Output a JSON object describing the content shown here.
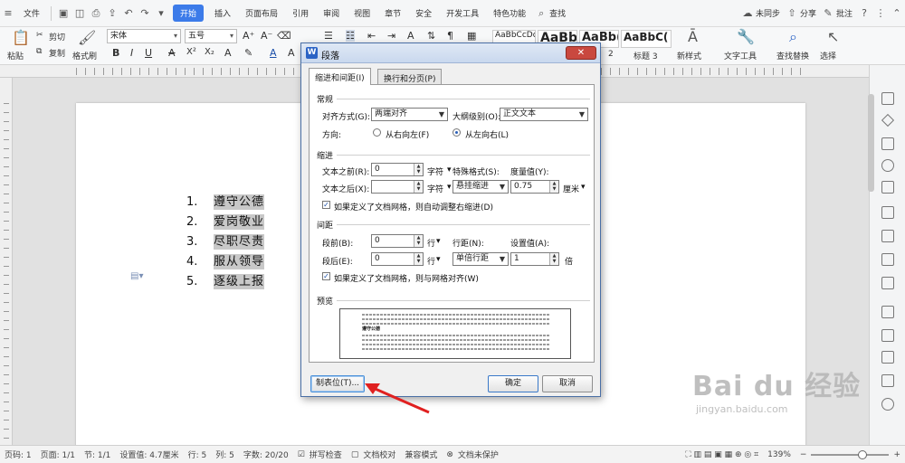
{
  "menubar": {
    "file": "文件",
    "tabs": [
      "开始",
      "插入",
      "页面布局",
      "引用",
      "审阅",
      "视图",
      "章节",
      "安全",
      "开发工具",
      "特色功能"
    ],
    "search": "查找",
    "sync": "未同步",
    "share": "分享",
    "comment": "批注",
    "help": "?",
    "more": "⋮"
  },
  "ribbon": {
    "paste": "粘贴",
    "cut": "剪切",
    "copy": "复制",
    "format_painter": "格式刷",
    "font_name": "宋体",
    "font_size": "五号",
    "styles": [
      "AaBbCcDd",
      "AaBb",
      "AaBb(",
      "AaBbC("
    ],
    "style_labels": [
      "2",
      "标题 3"
    ],
    "new_style": "新样式",
    "text_tools": "文字工具",
    "find_replace": "查找替换",
    "select": "选择"
  },
  "document": {
    "list": [
      {
        "num": "1.",
        "text": "遵守公德"
      },
      {
        "num": "2.",
        "text": "爱岗敬业"
      },
      {
        "num": "3.",
        "text": "尽职尽责"
      },
      {
        "num": "4.",
        "text": "服从领导"
      },
      {
        "num": "5.",
        "text": "逐级上报"
      }
    ]
  },
  "dialog": {
    "title": "段落",
    "close": "✕",
    "tabs": [
      "缩进和间距(I)",
      "换行和分页(P)"
    ],
    "general": {
      "header": "常规",
      "align_label": "对齐方式(G):",
      "align_value": "两端对齐",
      "outline_label": "大纲级别(O):",
      "outline_value": "正文文本",
      "direction_label": "方向:",
      "rtl": "从右向左(F)",
      "ltr": "从左向右(L)"
    },
    "indent": {
      "header": "缩进",
      "before_label": "文本之前(R):",
      "before_value": "0",
      "before_unit": "字符",
      "after_label": "文本之后(X):",
      "after_value": "",
      "after_unit": "字符",
      "special_label": "特殊格式(S):",
      "special_value": "悬挂缩进",
      "measure_label": "度量值(Y):",
      "measure_value": "0.75",
      "measure_unit": "厘米",
      "auto_adjust": "如果定义了文档网格，则自动调整右缩进(D)"
    },
    "spacing": {
      "header": "间距",
      "before_label": "段前(B):",
      "before_value": "0",
      "before_unit": "行",
      "after_label": "段后(E):",
      "after_value": "0",
      "after_unit": "行",
      "line_label": "行距(N):",
      "line_value": "单倍行距",
      "setting_label": "设置值(A):",
      "setting_value": "1",
      "setting_unit": "倍",
      "grid_align": "如果定义了文档网格，则与网格对齐(W)"
    },
    "preview": {
      "header": "预览",
      "sample": "遵守公德"
    },
    "buttons": {
      "tabs": "制表位(T)...",
      "ok": "确定",
      "cancel": "取消"
    }
  },
  "statusbar": {
    "page_no": "页码: 1",
    "pages": "页面: 1/1",
    "section": "节: 1/1",
    "setting": "设置值: 4.7厘米",
    "row": "行: 5",
    "col": "列: 5",
    "words": "字数: 20/20",
    "spellcheck": "拼写检查",
    "doc_check": "文档校对",
    "compat": "兼容模式",
    "protect": "文档未保护",
    "zoom": "139%",
    "minus": "−",
    "plus": "+"
  },
  "watermark": {
    "text": "Bai du 经验",
    "url": "jingyan.baidu.com"
  }
}
